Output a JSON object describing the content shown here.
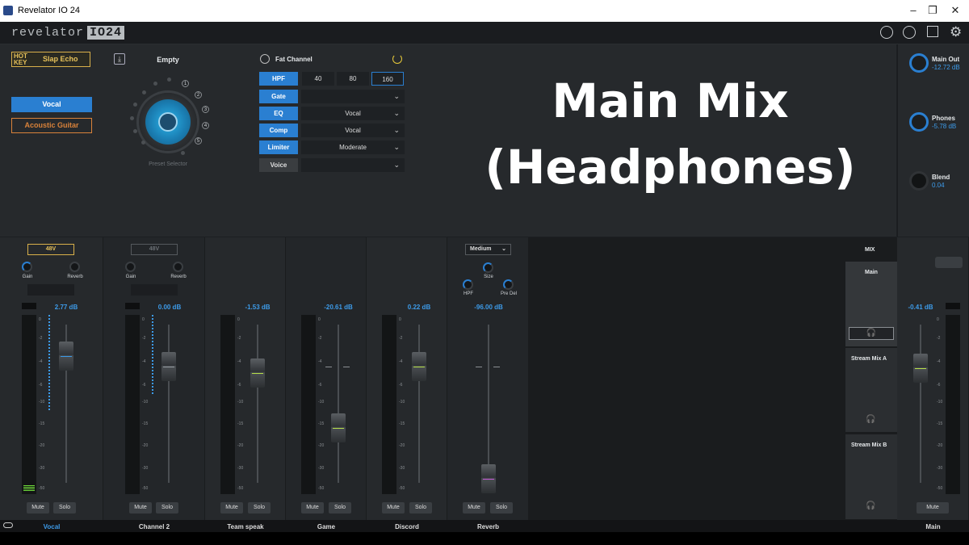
{
  "titlebar": {
    "title": "Revelator IO 24",
    "minimize": "–",
    "maximize": "❐",
    "close": "✕"
  },
  "header": {
    "logo_text": "revelator",
    "logo_badge": "IO24"
  },
  "hotkey": {
    "label": "HOT KEY",
    "value": "Slap Echo"
  },
  "presets": {
    "vocal": "Vocal",
    "guitar": "Acoustic Guitar"
  },
  "preset_selector": {
    "name": "Empty",
    "label": "Preset Selector",
    "nums": [
      "1",
      "2",
      "3",
      "4",
      "5"
    ]
  },
  "fat_channel": {
    "title": "Fat Channel",
    "hpf": {
      "label": "HPF",
      "options": [
        "40",
        "80",
        "160"
      ],
      "selected": "160"
    },
    "gate": {
      "label": "Gate",
      "value": ""
    },
    "eq": {
      "label": "EQ",
      "value": "Vocal"
    },
    "comp": {
      "label": "Comp",
      "value": "Vocal"
    },
    "limiter": {
      "label": "Limiter",
      "value": "Moderate"
    },
    "voice": {
      "label": "Voice",
      "value": ""
    }
  },
  "overlay": {
    "line1": "Main Mix",
    "line2": "(Headphones)"
  },
  "outputs": {
    "main_out": {
      "label": "Main Out",
      "value": "-12.72 dB"
    },
    "phones": {
      "label": "Phones",
      "value": "-5.78 dB"
    },
    "blend": {
      "label": "Blend",
      "value": "0.04"
    }
  },
  "channels": [
    {
      "name": "Vocal",
      "db": "2.77 dB",
      "phantom": "48V",
      "gain": "Gain",
      "reverb": "Reverb",
      "mute": "Mute",
      "solo": "Solo"
    },
    {
      "name": "Channel 2",
      "db": "0.00 dB",
      "phantom": "48V",
      "gain": "Gain",
      "reverb": "Reverb",
      "mute": "Mute",
      "solo": "Solo"
    },
    {
      "name": "Team speak",
      "db": "-1.53 dB",
      "mute": "Mute",
      "solo": "Solo"
    },
    {
      "name": "Game",
      "db": "-20.61 dB",
      "mute": "Mute",
      "solo": "Solo"
    },
    {
      "name": "Discord",
      "db": "0.22 dB",
      "mute": "Mute",
      "solo": "Solo"
    },
    {
      "name": "Reverb",
      "db": "-96.00 dB",
      "preset": "Medium",
      "size": "Size",
      "hpf": "HPF",
      "predel": "Pre Del",
      "mute": "Mute",
      "solo": "Solo"
    }
  ],
  "scale_marks": [
    "0",
    "-2",
    "-4",
    "-6",
    "-10",
    "-15",
    "-20",
    "-30",
    "-50"
  ],
  "mix": {
    "title": "MIX",
    "main": "Main",
    "stream_a": "Stream Mix A",
    "stream_b": "Stream Mix B"
  },
  "main_channel": {
    "name": "Main",
    "db": "-0.41 dB",
    "mute": "Mute"
  },
  "colors": {
    "accent": "#2a7fd1",
    "value_blue": "#3d9be9",
    "hotkey": "#d9b04a",
    "guitar": "#d9823a"
  }
}
